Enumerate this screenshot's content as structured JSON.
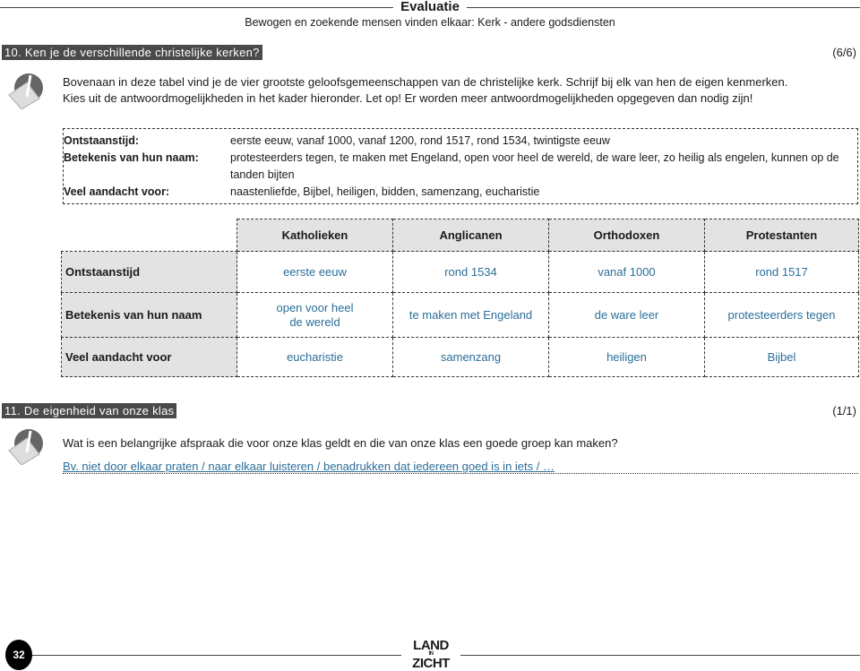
{
  "header": {
    "title": "Evaluatie",
    "subtitle": "Bewogen en zoekende mensen vinden elkaar: Kerk - andere godsdiensten"
  },
  "q10": {
    "heading": "10. Ken je de verschillende christelijke kerken?",
    "score": "(6/6)",
    "instruction_1": "Bovenaan in deze tabel vind je de vier grootste geloofsgemeenschappen van de christelijke kerk. Schrijf bij elk van hen de eigen kenmerken.",
    "instruction_2": "Kies uit de antwoordmogelijkheden in het kader hieronder. Let op! Er worden meer antwoordmogelijkheden opgegeven dan nodig zijn!",
    "options": [
      {
        "label": "Ontstaanstijd:",
        "value": "eerste eeuw, vanaf 1000, vanaf 1200, rond 1517, rond 1534, twintigste eeuw"
      },
      {
        "label": "Betekenis van hun naam:",
        "value": "protesteerders tegen, te maken met Engeland, open voor heel de wereld, de ware leer, zo heilig als engelen, kunnen op de tanden bijten"
      },
      {
        "label": "Veel aandacht voor:",
        "value": "naastenliefde, Bijbel, heiligen, bidden, samenzang, eucharistie"
      }
    ],
    "table": {
      "columns": [
        "Katholieken",
        "Anglicanen",
        "Orthodoxen",
        "Protestanten"
      ],
      "rows": [
        {
          "label": "Ontstaanstijd",
          "cells": [
            "eerste eeuw",
            "rond 1534",
            "vanaf 1000",
            "rond 1517"
          ]
        },
        {
          "label": "Betekenis van hun naam",
          "cells": [
            "open voor heel de wereld",
            "te maken met Engeland",
            "de ware leer",
            "protesteerders tegen"
          ]
        },
        {
          "label": "Veel aandacht voor",
          "cells": [
            "eucharistie",
            "samenzang",
            "heiligen",
            "Bijbel"
          ]
        }
      ]
    }
  },
  "q11": {
    "heading": "11. De eigenheid van onze klas",
    "score": "(1/1)",
    "question": "Wat is een belangrijke afspraak die voor onze klas geldt en die van onze klas een goede groep kan maken?",
    "answer": "Bv. niet door elkaar praten / naar elkaar luisteren / benadrukken dat iedereen goed is in iets / …"
  },
  "footer": {
    "page_number": "32",
    "logo": "LAND IN ZICHT"
  },
  "colors": {
    "answer": "#2b6e9a",
    "heading_bg": "#4a4a4a",
    "table_header_bg": "#e3e3e3"
  }
}
